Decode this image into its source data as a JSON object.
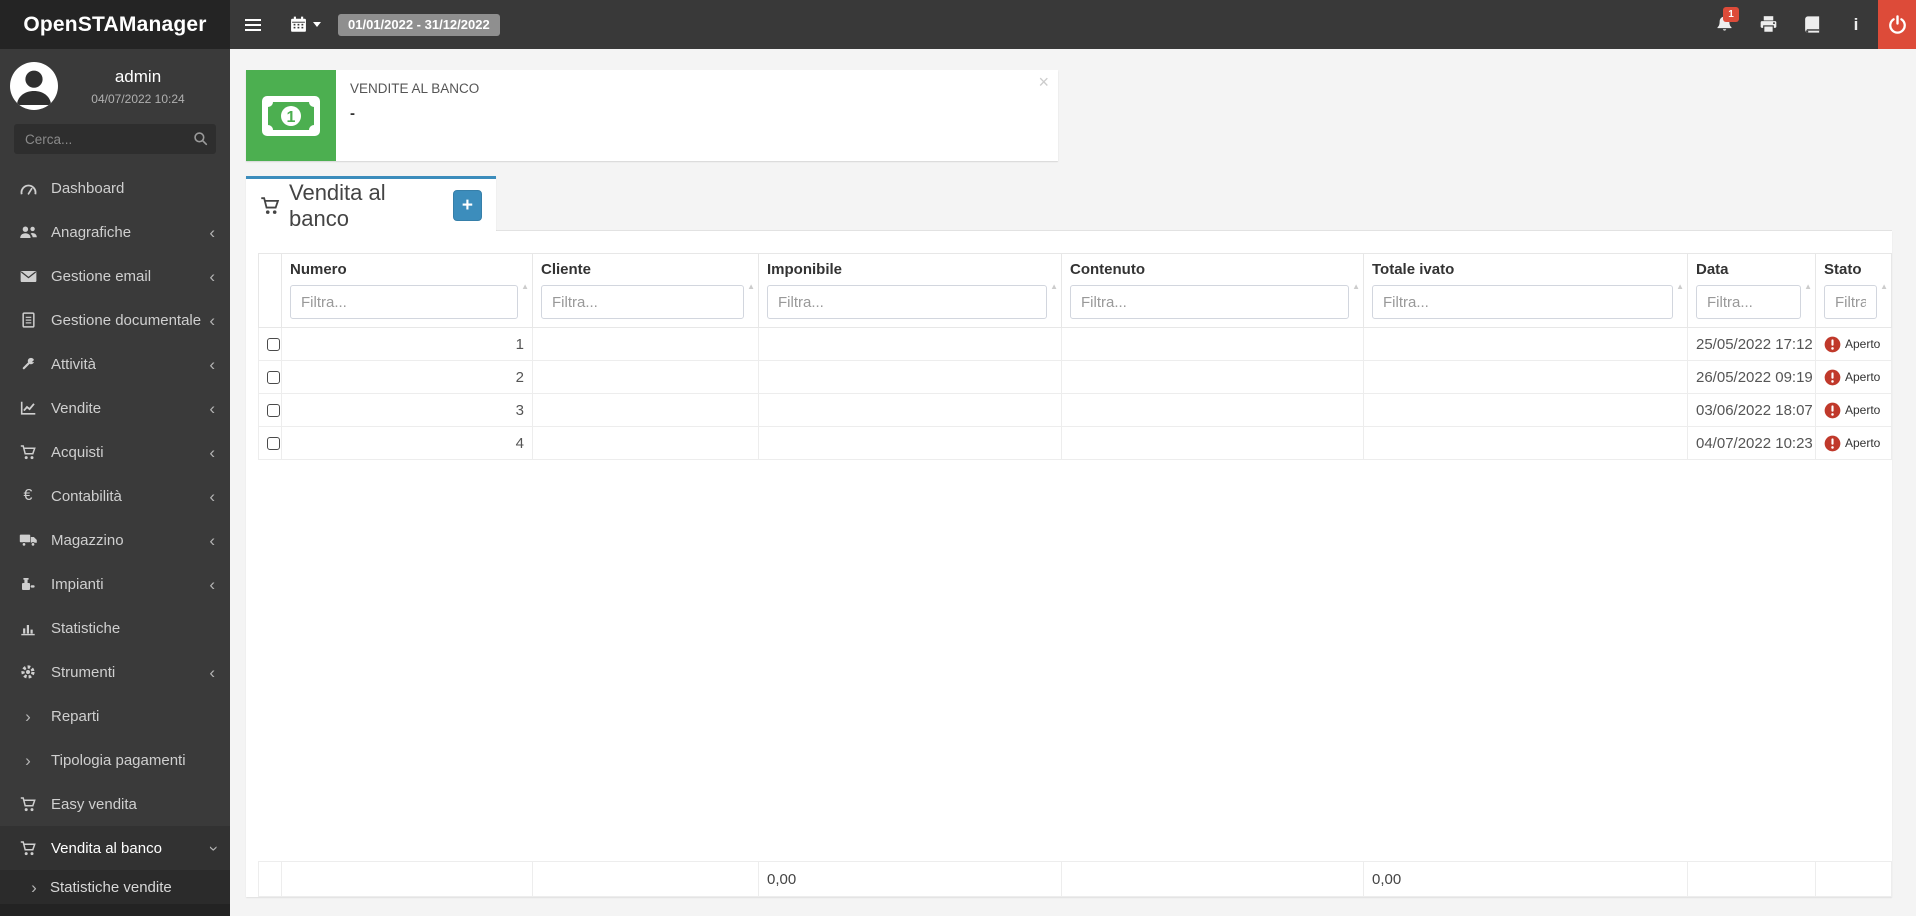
{
  "app": {
    "name": "OpenSTAManager"
  },
  "topbar": {
    "date_range": "01/01/2022 - 31/12/2022",
    "notifications_badge": "1"
  },
  "sidebar": {
    "user": {
      "name": "admin",
      "last_access": "04/07/2022 10:24"
    },
    "search": {
      "placeholder": "Cerca..."
    },
    "items": [
      {
        "label": "Dashboard",
        "icon": "gauge-icon"
      },
      {
        "label": "Anagrafiche",
        "icon": "users-icon",
        "expand": "collapsed"
      },
      {
        "label": "Gestione email",
        "icon": "envelope-icon",
        "expand": "collapsed"
      },
      {
        "label": "Gestione documentale",
        "icon": "document-icon",
        "expand": "collapsed"
      },
      {
        "label": "Attività",
        "icon": "wrench-icon",
        "expand": "collapsed"
      },
      {
        "label": "Vendite",
        "icon": "line-chart-icon",
        "expand": "collapsed"
      },
      {
        "label": "Acquisti",
        "icon": "cart-icon",
        "expand": "collapsed"
      },
      {
        "label": "Contabilità",
        "icon": "euro-icon",
        "expand": "collapsed"
      },
      {
        "label": "Magazzino",
        "icon": "truck-icon",
        "expand": "collapsed"
      },
      {
        "label": "Impianti",
        "icon": "machine-icon",
        "expand": "collapsed"
      },
      {
        "label": "Statistiche",
        "icon": "bar-chart-icon"
      },
      {
        "label": "Strumenti",
        "icon": "gear-icon",
        "expand": "collapsed"
      },
      {
        "label": "Reparti",
        "icon": "chevron-right-icon"
      },
      {
        "label": "Tipologia pagamenti",
        "icon": "chevron-right-icon"
      },
      {
        "label": "Easy vendita",
        "icon": "cart-icon"
      },
      {
        "label": "Vendita al banco",
        "icon": "cart-icon",
        "expand": "expanded",
        "active": true
      },
      {
        "label": "Statistiche vendite",
        "icon": "chevron-right-icon",
        "submenu": true
      }
    ]
  },
  "widget": {
    "title": "VENDITE AL BANCO",
    "value": "-",
    "close_label": "×",
    "icon": "money-bill-icon",
    "color": "#4caf50"
  },
  "panel": {
    "title": "Vendita al banco",
    "add_button_label": "+",
    "accent_color": "#3c8dbc"
  },
  "table": {
    "filter_placeholder": "Filtra...",
    "columns": [
      "Numero",
      "Cliente",
      "Imponibile",
      "Contenuto",
      "Totale ivato",
      "Data",
      "Stato"
    ],
    "rows": [
      {
        "numero": "1",
        "cliente": "",
        "imponibile": "",
        "contenuto": "",
        "totale_ivato": "",
        "data": "25/05/2022 17:12",
        "stato": "Aperto"
      },
      {
        "numero": "2",
        "cliente": "",
        "imponibile": "",
        "contenuto": "",
        "totale_ivato": "",
        "data": "26/05/2022 09:19",
        "stato": "Aperto"
      },
      {
        "numero": "3",
        "cliente": "",
        "imponibile": "",
        "contenuto": "",
        "totale_ivato": "",
        "data": "03/06/2022 18:07",
        "stato": "Aperto"
      },
      {
        "numero": "4",
        "cliente": "",
        "imponibile": "",
        "contenuto": "",
        "totale_ivato": "",
        "data": "04/07/2022 10:23",
        "stato": "Aperto"
      }
    ],
    "footer": {
      "imponibile_total": "0,00",
      "totale_ivato_total": "0,00"
    },
    "status_color": "#c0392b"
  },
  "colors": {
    "topbar_bg": "#393939",
    "logo_bg": "#242424",
    "sidebar_bg": "#3a3a3a",
    "power_button_bg": "#dd4b39",
    "page_bg": "#f4f4f4"
  }
}
